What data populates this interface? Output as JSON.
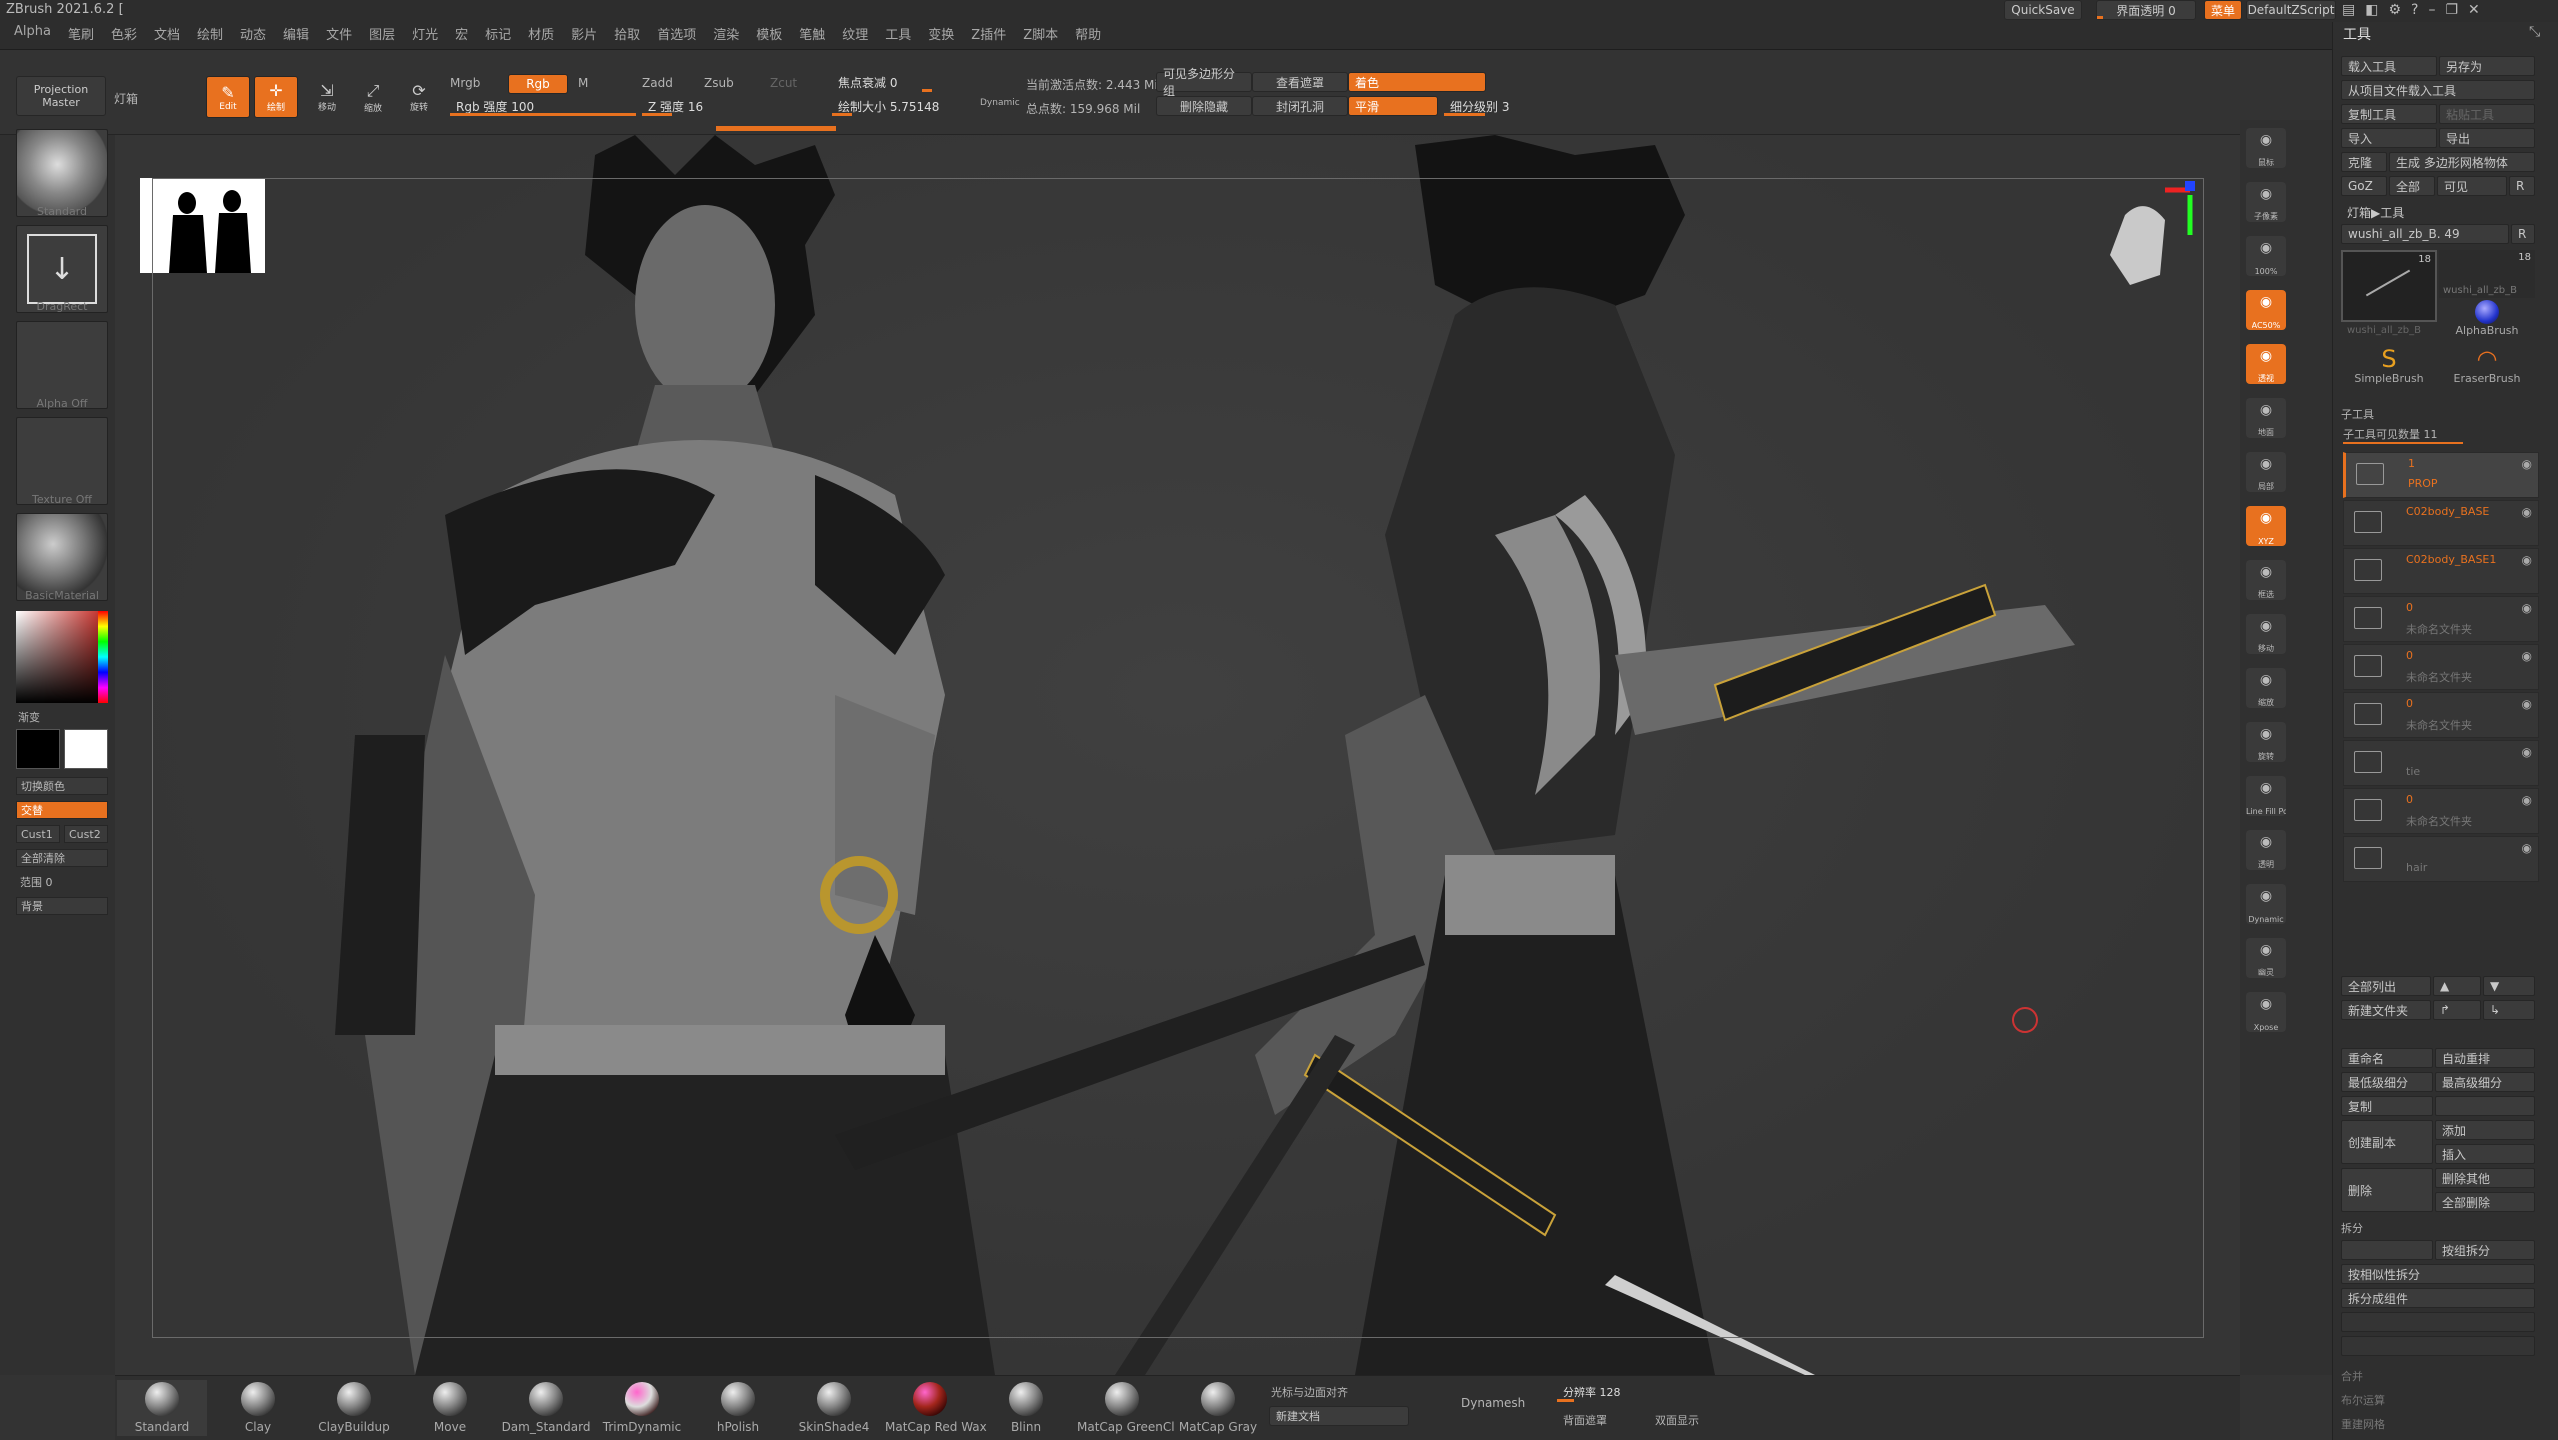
{
  "app": {
    "title": "ZBrush 2021.6.2 ["
  },
  "menu": [
    "Alpha",
    "笔刷",
    "色彩",
    "文档",
    "绘制",
    "动态",
    "编辑",
    "文件",
    "图层",
    "灯光",
    "宏",
    "标记",
    "材质",
    "影片",
    "拾取",
    "首选项",
    "渲染",
    "模板",
    "笔触",
    "纹理",
    "工具",
    "变换",
    "Z插件",
    "Z脚本",
    "帮助"
  ],
  "topright": {
    "quicksave": "QuickSave",
    "transparency": "界面透明 0",
    "menu_btn": "菜单",
    "script": "DefaultZScript"
  },
  "shelf": {
    "projection_master": "Projection Master",
    "lightbox": "灯箱",
    "edit": "Edit",
    "draw": "绘制",
    "move": "移动",
    "scale": "缩放",
    "rotate": "旋转",
    "mrgb": "Mrgb",
    "rgb": "Rgb",
    "m": "M",
    "rgb_intensity": "Rgb 强度 100",
    "zadd": "Zadd",
    "zsub": "Zsub",
    "zcut": "Zcut",
    "z_intensity": "Z 强度 16",
    "focal_shift": "焦点衰减 0",
    "draw_size": "绘制大小 5.75148",
    "dynamic": "Dynamic",
    "active_points": "当前激活点数: 2.443 Mil",
    "total_points": "总点数: 159.968 Mil",
    "visible_polygroup": "可见多边形分组",
    "delete_hidden": "删除隐藏",
    "view_mask": "查看遮罩",
    "close_holes": "封闭孔洞",
    "coloring": "着色",
    "smooth": "平滑",
    "subdiv_level": "细分级别 3",
    "focal_bar": 0.0,
    "rgb_bar": 1.0,
    "z_bar": 0.16,
    "subdiv_bar": 0.45
  },
  "left": {
    "brush": "Standard",
    "stroke": "DragRect",
    "alpha": "Alpha Off",
    "texture": "Texture Off",
    "material": "BasicMaterial",
    "gradient": "渐变",
    "switch_color": "切换颜色",
    "alternate": "交替",
    "cust1": "Cust1",
    "cust2": "Cust2",
    "clear_all": "全部清除",
    "range": "范围 0",
    "background": "背景"
  },
  "right_icons": [
    "鼠标",
    "子像素",
    "100%",
    "AC50%",
    "透视",
    "地面",
    "局部",
    "XYZ",
    "框选",
    "移动",
    "缩放",
    "旋转",
    "Line Fill PolyF",
    "透明",
    "Dynamic",
    "幽灵",
    "Xpose"
  ],
  "panel": {
    "title": "工具",
    "load_tool": "载入工具",
    "save_as": "另存为",
    "load_from_project": "从项目文件载入工具",
    "copy_tool": "复制工具",
    "paste_tool": "粘贴工具",
    "import": "导入",
    "export": "导出",
    "clone": "克隆",
    "make_polymesh": "生成 多边形网格物体",
    "goz": "GoZ",
    "all": "全部",
    "visible": "可见",
    "r": "R",
    "lightbox_tool": "灯箱▶工具",
    "current_tool": "wushi_all_zb_B. 49",
    "thumbs": [
      {
        "name": "wushi_all_zb_B",
        "count": "18"
      },
      {
        "name": "wushi_all_zb_B",
        "count": "18"
      },
      {
        "name": "AlphaBrush",
        "count": ""
      },
      {
        "name": "SimpleBrush",
        "count": ""
      },
      {
        "name": "EraserBrush",
        "count": ""
      }
    ],
    "subtool_header": "子工具",
    "subtool_count": "子工具可见数量 11",
    "subtools": [
      {
        "name": "1",
        "sub": "PROP"
      },
      {
        "name": "C02body_BASE",
        "sub": ""
      },
      {
        "name": "C02body_BASE1",
        "sub": ""
      },
      {
        "name": "0",
        "sub": "未命名文件夹"
      },
      {
        "name": "0",
        "sub": "未命名文件夹"
      },
      {
        "name": "0",
        "sub": "未命名文件夹"
      },
      {
        "name": "",
        "sub": "tie"
      },
      {
        "name": "0",
        "sub": "未命名文件夹"
      },
      {
        "name": "",
        "sub": "hair"
      }
    ],
    "list_all": "全部列出",
    "new_folder": "新建文件夹",
    "rename": "重命名",
    "auto_reorder": "自动重排",
    "lowest_subdiv": "最低级细分",
    "highest_subdiv": "最高级细分",
    "duplicate": "复制",
    "append": "添加",
    "insert": "插入",
    "create_copy": "创建副本",
    "delete": "删除",
    "delete_others": "删除其他",
    "delete_all": "全部删除",
    "split_header": "拆分",
    "split_groups": "按组拆分",
    "split_similar": "按相似性拆分",
    "split_parts": "拆分成组件",
    "merge": "合并",
    "boolean": "布尔运算",
    "remesh": "重建网格"
  },
  "bottom": {
    "brushes": [
      "Standard",
      "Clay",
      "ClayBuildup",
      "Move",
      "Dam_Standard",
      "TrimDynamic",
      "hPolish",
      "SkinShade4",
      "MatCap Red Wax",
      "Blinn",
      "MatCap GreenCl",
      "MatCap Gray"
    ],
    "cursor_align": "光标与边面对齐",
    "new_doc": "新建文档",
    "dynamesh": "Dynamesh",
    "resolution": "分辨率 128",
    "back_mask": "背面遮罩",
    "double_display": "双面显示",
    "resolution_bar": 0.12
  },
  "colors": {
    "accent": "#e8711f",
    "canvas": "#393939"
  }
}
